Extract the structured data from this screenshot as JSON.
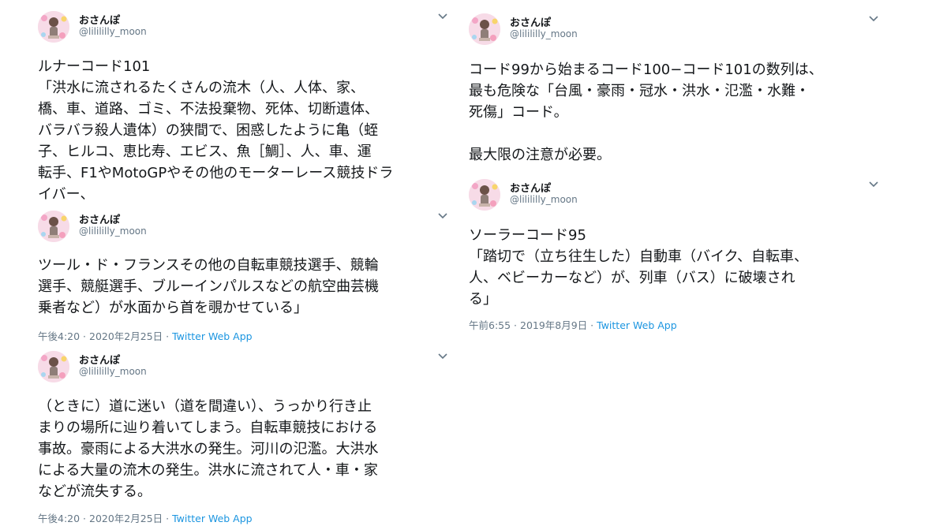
{
  "colors": {
    "text": "#14171a",
    "secondary": "#657786",
    "link": "#1b95e0"
  },
  "icons": {
    "avatar": "avatar-image",
    "menu": "chevron-down-icon"
  },
  "tweets": [
    {
      "author_name": "おさんぽ",
      "author_handle": "@lilililly_moon",
      "text": "ルナーコード101\n「洪水に流されるたくさんの流木（人、人体、家、\n橋、車、道路、ゴミ、不法投棄物、死体、切断遺体、\nバラバラ殺人遺体）の狭間で、困惑したように亀（蛭\n子、ヒルコ、恵比寿、エビス、魚［鯛］、人、車、運\n転手、F1やMotoGPやその他のモーターレース競技ドラ\nイバー、"
    },
    {
      "author_name": "おさんぽ",
      "author_handle": "@lilililly_moon",
      "text": "ツール・ド・フランスその他の自転車競技選手、競輪\n選手、競艇選手、ブルーインパルスなどの航空曲芸機\n乗者など）が水面から首を覗かせている」",
      "timestamp": "午後4:20 · 2020年2月25日 · ",
      "source": "Twitter Web App"
    },
    {
      "author_name": "おさんぽ",
      "author_handle": "@lilililly_moon",
      "text": "（ときに）道に迷い（道を間違い）、うっかり行き止\nまりの場所に辿り着いてしまう。自転車競技における\n事故。豪雨による大洪水の発生。河川の氾濫。大洪水\nによる大量の流木の発生。洪水に流されて人・車・家\nなどが流失する。",
      "timestamp": "午後4:20 · 2020年2月25日 · ",
      "source": "Twitter Web App"
    },
    {
      "author_name": "おさんぽ",
      "author_handle": "@lilililly_moon",
      "text": "コード99から始まるコード100−コード101の数列は、\n最も危険な「台風・豪雨・冠水・洪水・氾濫・水難・\n死傷」コード。\n\n最大限の注意が必要。"
    },
    {
      "author_name": "おさんぽ",
      "author_handle": "@lilililly_moon",
      "text": "ソーラーコード95\n「踏切で（立ち往生した）自動車（バイク、自転車、\n人、ベビーカーなど）が、列車（バス）に破壊され\nる」",
      "timestamp": "午前6:55 · 2019年8月9日 · ",
      "source": "Twitter Web App"
    }
  ]
}
